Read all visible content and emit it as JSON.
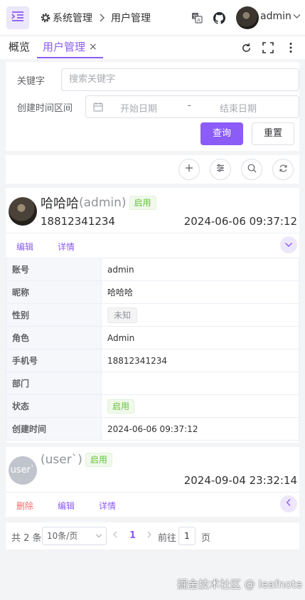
{
  "header": {
    "breadcrumb": [
      "系统管理",
      "用户管理"
    ],
    "username": "admin"
  },
  "tabs": [
    {
      "label": "概览"
    },
    {
      "label": "用户管理",
      "close": "×"
    }
  ],
  "search": {
    "keyword_label": "关键字",
    "keyword_placeholder": "搜索关键字",
    "date_label": "创建时间区间",
    "start_placeholder": "开始日期",
    "separator": "-",
    "end_placeholder": "结束日期",
    "query_button": "查询",
    "reset_button": "重置"
  },
  "users": [
    {
      "avatar_text": "",
      "display_name": "哈哈哈",
      "username_suffix": "(admin)",
      "status": "启用",
      "phone": "18812341234",
      "created": "2024-06-06 09:37:12",
      "actions": [
        "编辑",
        "详情"
      ],
      "details": [
        {
          "key": "账号",
          "value": "admin",
          "type": "text"
        },
        {
          "key": "昵称",
          "value": "哈哈哈",
          "type": "text"
        },
        {
          "key": "性别",
          "value": "未知",
          "type": "gray-tag"
        },
        {
          "key": "角色",
          "value": "Admin",
          "type": "text"
        },
        {
          "key": "手机号",
          "value": "18812341234",
          "type": "text"
        },
        {
          "key": "部门",
          "value": "",
          "type": "text"
        },
        {
          "key": "状态",
          "value": "启用",
          "type": "green-tag"
        },
        {
          "key": "创建时间",
          "value": "2024-06-06 09:37:12",
          "type": "text"
        }
      ]
    },
    {
      "avatar_text": "user`",
      "display_name": "",
      "username_suffix": "(user`)",
      "status": "启用",
      "phone": "",
      "created": "2024-09-04 23:32:14",
      "actions": [
        "删除",
        "编辑",
        "详情"
      ]
    }
  ],
  "pagination": {
    "total": "共 2 条",
    "page_size": "10条/页",
    "current_page": "1",
    "goto_label": "前往",
    "goto_value": "1",
    "page_unit": "页"
  },
  "watermark": "掘金技术社区 @ leafnote",
  "colors": {
    "primary": "#8b5cf6",
    "success": "#67c23a",
    "danger": "#f56c6c"
  }
}
